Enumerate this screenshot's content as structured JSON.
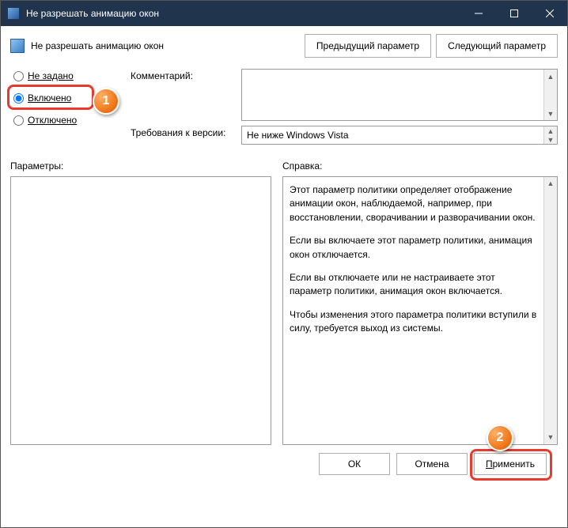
{
  "titlebar": {
    "title": "Не разрешать анимацию окон"
  },
  "header": {
    "title": "Не разрешать анимацию окон"
  },
  "nav": {
    "prev": "Предыдущий параметр",
    "next": "Следующий параметр"
  },
  "radios": {
    "not_configured": "Не задано",
    "enabled": "Включено",
    "disabled": "Отключено"
  },
  "labels": {
    "comment": "Комментарий:",
    "version_req": "Требования к версии:",
    "params": "Параметры:",
    "help": "Справка:"
  },
  "version_value": "Не ниже Windows Vista",
  "help_text": {
    "p1": "Этот параметр политики определяет отображение анимации окон, наблюдаемой, например, при восстановлении, сворачивании и разворачивании окон.",
    "p2": "Если вы включаете этот параметр политики, анимация окон отключается.",
    "p3": "Если вы отключаете или не настраиваете этот параметр политики, анимация окон включается.",
    "p4": "Чтобы изменения этого параметра политики вступили в силу, требуется выход из системы."
  },
  "footer": {
    "ok": "ОК",
    "cancel": "Отмена",
    "apply": "Применить"
  },
  "badges": {
    "one": "1",
    "two": "2"
  }
}
